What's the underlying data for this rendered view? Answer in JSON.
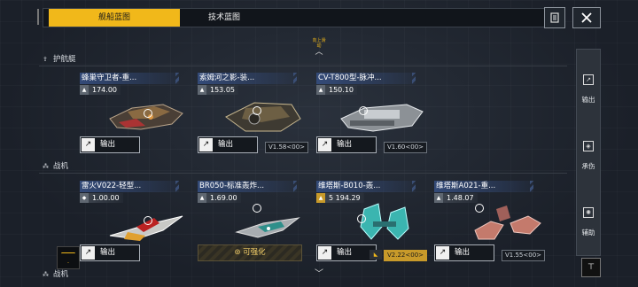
{
  "tabs": [
    {
      "label": "舰船蓝图",
      "active": true
    },
    {
      "label": "技术蓝图",
      "active": false
    }
  ],
  "top_hint": "向上滑动",
  "sections": [
    {
      "label": "护航艇"
    },
    {
      "label": "战机"
    },
    {
      "label": "战机"
    }
  ],
  "cards": [
    {
      "name": "蜂巢守卫者-重...",
      "power": "174.00",
      "power_icon": "flask-icon",
      "action": "输出",
      "version": "",
      "enhance": ""
    },
    {
      "name": "索姆河之影-装...",
      "power": "153.05",
      "power_icon": "flask-icon",
      "action": "输出",
      "version": "V1.58<00>",
      "enhance": ""
    },
    {
      "name": "CV-T800型-脉冲...",
      "power": "150.10",
      "power_icon": "flask-icon",
      "action": "输出",
      "version": "V1.60<00>",
      "enhance": ""
    },
    {
      "name": "雷火V022-轻型...",
      "power": "1.00.00",
      "power_icon": "shield-icon",
      "action": "输出",
      "version": "",
      "enhance": ""
    },
    {
      "name": "BR050-标准轰炸...",
      "power": "1.69.00",
      "power_icon": "flask-icon",
      "action": "",
      "version": "",
      "enhance": "可强化"
    },
    {
      "name": "维塔斯-B010-轰...",
      "power": "5 194.29",
      "power_icon": "flask-icon",
      "action": "输出",
      "version": "V2.22<00>",
      "enhance": ""
    },
    {
      "name": "维塔斯A021-重...",
      "power": "1.48.07",
      "power_icon": "flask-icon",
      "action": "输出",
      "version": "V1.55<00>",
      "enhance": ""
    }
  ],
  "sidebar": [
    {
      "label": "输出",
      "icon": "arrow-upright-icon"
    },
    {
      "label": "承伤",
      "icon": "shield-icon"
    },
    {
      "label": "辅助",
      "icon": "gear-icon"
    }
  ],
  "colors": {
    "accent": "#f1b81a",
    "panel": "#1b2029",
    "name_bar": "#334a78"
  }
}
